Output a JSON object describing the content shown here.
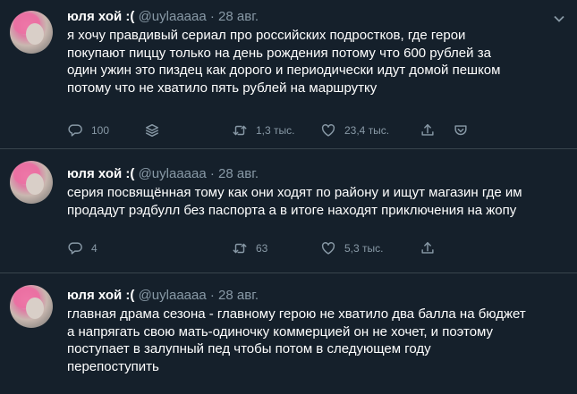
{
  "tweets": [
    {
      "name": "юля хой :(",
      "handle": "@uylaaaaa",
      "dot": "·",
      "date": "28 авг.",
      "lines": [
        "я хочу правдивый сериал про российских подростков, где герои",
        "покупают пиццу только на день рождения потому что 600 рублей за",
        "один ужин это пиздец как дорого и периодически идут домой пешком",
        "потому что не хватило пять рублей на маршрутку"
      ],
      "replies": "100",
      "retweets": "1,3 тыс.",
      "likes": "23,4 тыс."
    },
    {
      "name": "юля хой :(",
      "handle": "@uylaaaaa",
      "dot": "·",
      "date": "28 авг.",
      "lines": [
        "серия посвящённая тому как они ходят по району и ищут магазин где им",
        "продадут рэдбулл без паспорта а в итоге находят приключения на жопу"
      ],
      "replies": "4",
      "retweets": "63",
      "likes": "5,3 тыс."
    },
    {
      "name": "юля хой :(",
      "handle": "@uylaaaaa",
      "dot": "·",
      "date": "28 авг.",
      "lines": [
        "главная драма сезона - главному герою не хватило два балла на бюджет",
        "а напрягать свою мать-одиночку коммерцией он не хочет, и поэтому",
        "поступает в залупный пед чтобы потом в следующем году",
        "перепоступить"
      ]
    }
  ]
}
